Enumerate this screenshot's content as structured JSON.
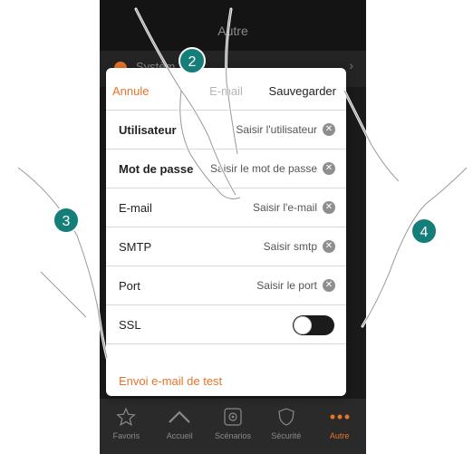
{
  "background_screen": {
    "header_title": "Autre",
    "row_label": "Systèm",
    "row_chevron": "›"
  },
  "dialog": {
    "cancel_label": "Annule",
    "title": "E-mail",
    "save_label": "Sauvegarder",
    "fields": [
      {
        "label": "Utilisateur",
        "value": "Saisir l'utilisateur"
      },
      {
        "label": "Mot de passe",
        "value": "Saisir le mot de passe"
      },
      {
        "label": "E-mail",
        "value": "Saisir l'e-mail"
      },
      {
        "label": "SMTP",
        "value": "Saisir smtp"
      },
      {
        "label": "Port",
        "value": "Saisir le port"
      }
    ],
    "ssl_label": "SSL",
    "ssl_enabled": false,
    "test_link": "Envoi e-mail de test"
  },
  "tabbar": {
    "tabs": [
      {
        "label": "Favoris",
        "icon": "star-icon",
        "active": false
      },
      {
        "label": "Accueil",
        "icon": "home-icon",
        "active": false
      },
      {
        "label": "Scénarios",
        "icon": "scenarios-icon",
        "active": false
      },
      {
        "label": "Sécurité",
        "icon": "shield-icon",
        "active": false
      },
      {
        "label": "Autre",
        "icon": "more-icon",
        "active": true
      }
    ]
  },
  "callouts": {
    "step2": "2",
    "step3": "3",
    "step4": "4"
  },
  "colors": {
    "accent": "#e8732a",
    "callout": "#157e79",
    "phone_bg": "#1a1a1a"
  }
}
